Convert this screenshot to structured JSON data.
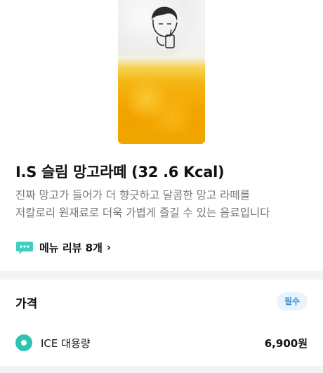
{
  "menu": {
    "title": "I.S 슬림 망고라떼 (32 .6 Kcal)",
    "description_lines": [
      "진짜 망고가 들어가 더 향긋하고 달콤한 망고 라떼를",
      "저칼로리 원재료로 더욱 가볍게 즐길 수 있는 음료입니다"
    ],
    "review_link": "메뉴 리뷰 8개",
    "review_chevron": "›",
    "review_icon": "chat-bubble-icon",
    "product_image": "mango-latte-cup-image"
  },
  "price_section": {
    "title": "가격",
    "badge": "필수",
    "options": [
      {
        "name": "ICE 대용량",
        "price": "6,900원",
        "selected": true
      }
    ]
  },
  "colors": {
    "accent_teal": "#2ec4b0",
    "badge_bg": "#e8f3fb",
    "badge_text": "#3a8fd0",
    "mango": "#f2a300"
  }
}
